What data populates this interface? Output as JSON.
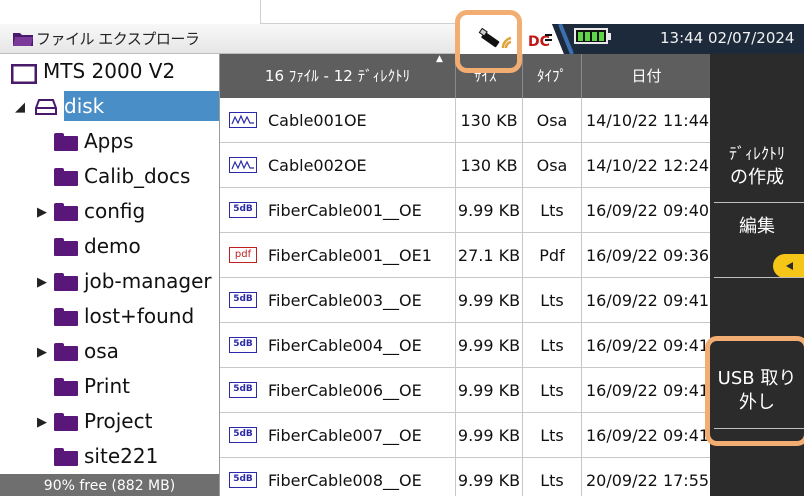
{
  "window": {
    "title": "ファイル エクスプローラ",
    "time": "13:44",
    "date": "02/07/2024",
    "icons": [
      "folder-icon",
      "usb-wifi-icon",
      "dc-power-icon",
      "battery-icon"
    ]
  },
  "tree": {
    "root": "MTS 2000 V2",
    "drive": "disk",
    "folders": [
      {
        "label": "Apps",
        "expandable": false
      },
      {
        "label": "Calib_docs",
        "expandable": false
      },
      {
        "label": "config",
        "expandable": true
      },
      {
        "label": "demo",
        "expandable": false
      },
      {
        "label": "job-manager",
        "expandable": true
      },
      {
        "label": "lost+found",
        "expandable": false
      },
      {
        "label": "osa",
        "expandable": true
      },
      {
        "label": "Print",
        "expandable": false
      },
      {
        "label": "Project",
        "expandable": true
      },
      {
        "label": "site221",
        "expandable": false
      }
    ],
    "free_space": "90% free (882 MB)"
  },
  "table": {
    "summary": "16 ﾌｧｲﾙ - 12 ﾃﾞｨﾚｸﾄﾘ",
    "col_size": "ｻｲｽﾞ",
    "col_type": "ﾀｲﾌﾟ",
    "col_date": "日付",
    "rows": [
      {
        "icon": "otdr-trace-icon",
        "name": "Cable001OE",
        "size": "130 KB",
        "type": "Osa",
        "date": "14/10/22 11:44"
      },
      {
        "icon": "otdr-trace-icon",
        "name": "Cable002OE",
        "size": "130 KB",
        "type": "Osa",
        "date": "14/10/22 12:24"
      },
      {
        "icon": "lts-file-icon",
        "name": "FiberCable001__OE",
        "size": "9.99 KB",
        "type": "Lts",
        "date": "16/09/22 09:40"
      },
      {
        "icon": "pdf-file-icon",
        "name": "FiberCable001__OE1",
        "size": "27.1 KB",
        "type": "Pdf",
        "date": "16/09/22 09:36"
      },
      {
        "icon": "lts-file-icon",
        "name": "FiberCable003__OE",
        "size": "9.99 KB",
        "type": "Lts",
        "date": "16/09/22 09:41"
      },
      {
        "icon": "lts-file-icon",
        "name": "FiberCable004__OE",
        "size": "9.99 KB",
        "type": "Lts",
        "date": "16/09/22 09:41"
      },
      {
        "icon": "lts-file-icon",
        "name": "FiberCable006__OE",
        "size": "9.99 KB",
        "type": "Lts",
        "date": "16/09/22 09:41"
      },
      {
        "icon": "lts-file-icon",
        "name": "FiberCable007__OE",
        "size": "9.99 KB",
        "type": "Lts",
        "date": "16/09/22 09:41"
      },
      {
        "icon": "lts-file-icon",
        "name": "FiberCable008__OE",
        "size": "9.99 KB",
        "type": "Lts",
        "date": "20/09/22 17:55"
      }
    ],
    "icon_text": {
      "lts": "5dB",
      "pdf": "pdf"
    }
  },
  "softkeys": {
    "new_dir_line1": "ﾃﾞｨﾚｸﾄﾘ",
    "new_dir_line2": "の作成",
    "edit": "編集",
    "usb_eject_line1": "USB 取り",
    "usb_eject_line2": "外し"
  },
  "colors": {
    "selection": "#4a8ec8",
    "folder": "#5a177a",
    "header_bg": "#5e5e5e",
    "softkey_panel": "#2b2b2b",
    "highlight": "#f2ad72",
    "status_bar": "#1c2a3c"
  }
}
